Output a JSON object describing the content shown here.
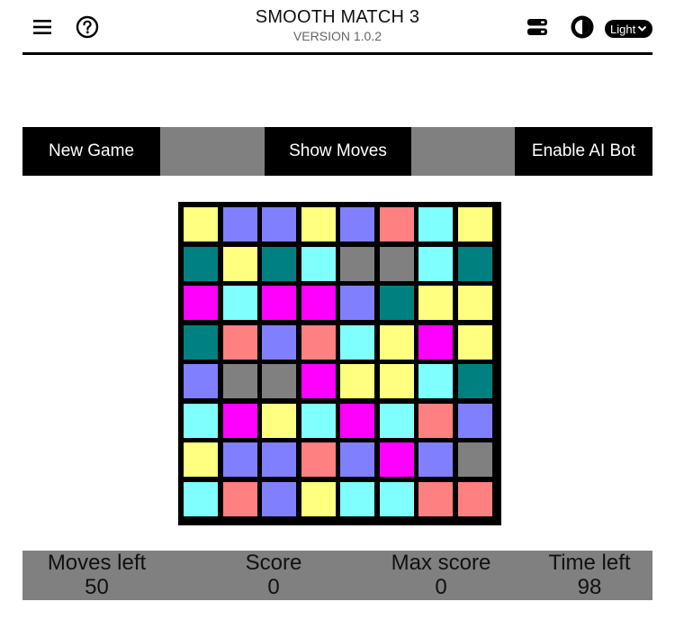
{
  "header": {
    "title": "SMOOTH MATCH 3",
    "version": "VERSION 1.0.2",
    "theme_select_value": "Light",
    "icons": [
      "menu-icon",
      "help-icon",
      "layout-icon",
      "theme-contrast-icon"
    ]
  },
  "toolbar": {
    "new_game": "New Game",
    "show_moves": "Show Moves",
    "enable_ai": "Enable AI Bot"
  },
  "colors": {
    "Y": "#ffff80",
    "B": "#8080ff",
    "C": "#80ffff",
    "R": "#ff8080",
    "T": "#008080",
    "G": "#808080",
    "M": "#ff00ff"
  },
  "board": {
    "rows": [
      [
        "Y",
        "B",
        "B",
        "Y",
        "B",
        "R",
        "C",
        "Y"
      ],
      [
        "T",
        "Y",
        "T",
        "C",
        "G",
        "G",
        "C",
        "T"
      ],
      [
        "M",
        "C",
        "M",
        "M",
        "B",
        "T",
        "Y",
        "Y"
      ],
      [
        "T",
        "R",
        "B",
        "R",
        "C",
        "Y",
        "M",
        "Y"
      ],
      [
        "B",
        "G",
        "G",
        "M",
        "Y",
        "Y",
        "C",
        "T"
      ],
      [
        "C",
        "M",
        "Y",
        "C",
        "M",
        "C",
        "R",
        "B"
      ],
      [
        "Y",
        "B",
        "B",
        "R",
        "B",
        "M",
        "B",
        "G"
      ],
      [
        "C",
        "R",
        "B",
        "Y",
        "C",
        "C",
        "R",
        "R"
      ]
    ]
  },
  "stats": {
    "moves_label": "Moves left",
    "moves_value": "50",
    "score_label": "Score",
    "score_value": "0",
    "max_label": "Max score",
    "max_value": "0",
    "time_label": "Time left",
    "time_value": "98"
  }
}
